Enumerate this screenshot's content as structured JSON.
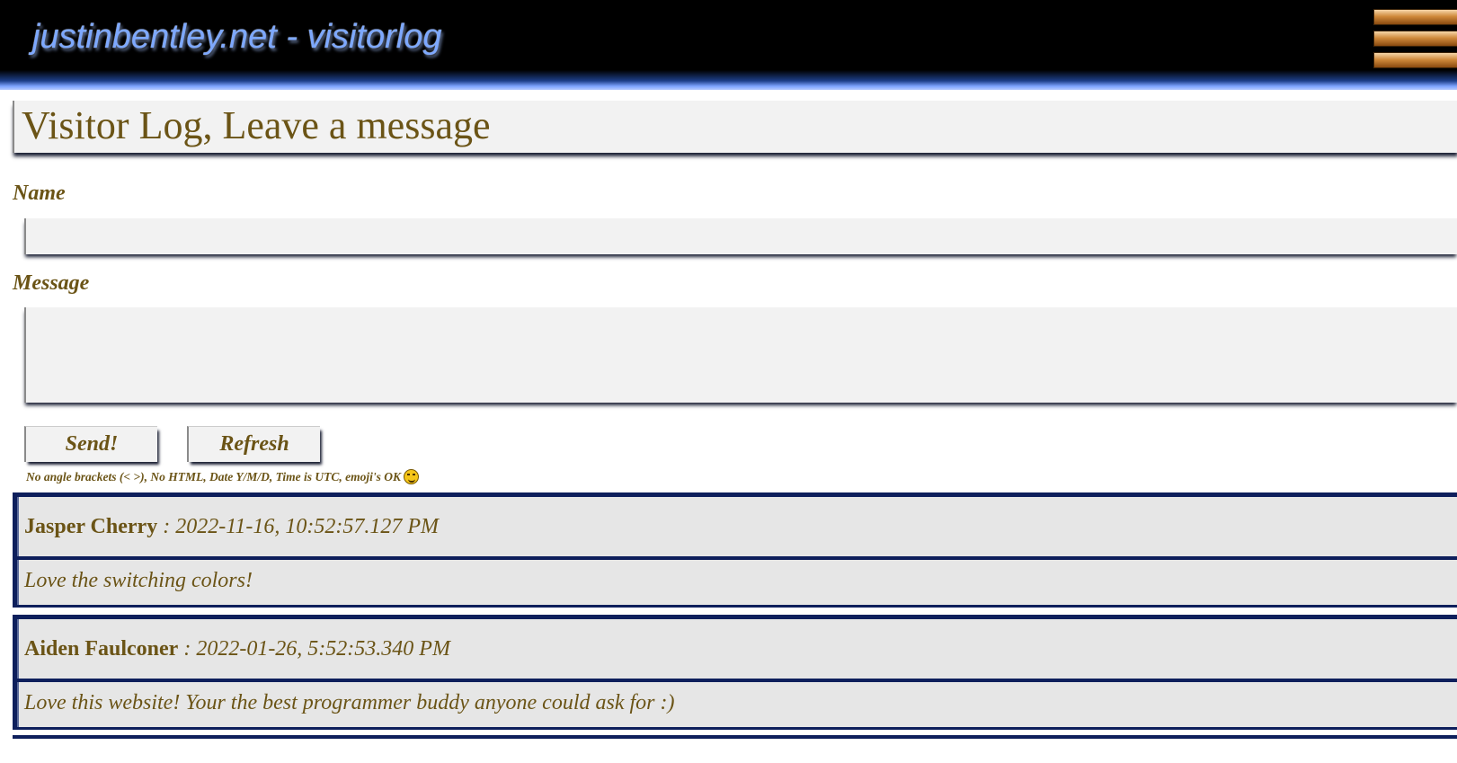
{
  "header": {
    "site_title": "justinbentley.net - visitorlog"
  },
  "page": {
    "heading": "Visitor Log, Leave a message"
  },
  "form": {
    "name_label": "Name",
    "name_value": "",
    "message_label": "Message",
    "message_value": "",
    "send_label": "Send!",
    "refresh_label": "Refresh",
    "rules_note": "No angle brackets (< >), No HTML, Date Y/M/D, Time is UTC, emoji's OK"
  },
  "entries": [
    {
      "name": "Jasper Cherry",
      "date": " : 2022-11-16, 10:52:57.127 PM",
      "message": "Love the switching colors!"
    },
    {
      "name": "Aiden Faulconer",
      "date": " : 2022-01-26, 5:52:53.340 PM",
      "message": "Love this website!  Your the best programmer buddy anyone could ask for :)"
    }
  ],
  "icons": {
    "menu": "hamburger-menu-icon",
    "emoji": "smiling-face-emoji-icon"
  },
  "colors": {
    "text": "#6b5416",
    "header_bg": "#000000",
    "title_blue": "#7da8ff",
    "entry_border": "#0e1f5c",
    "menu_gold": "#d08a3c"
  }
}
